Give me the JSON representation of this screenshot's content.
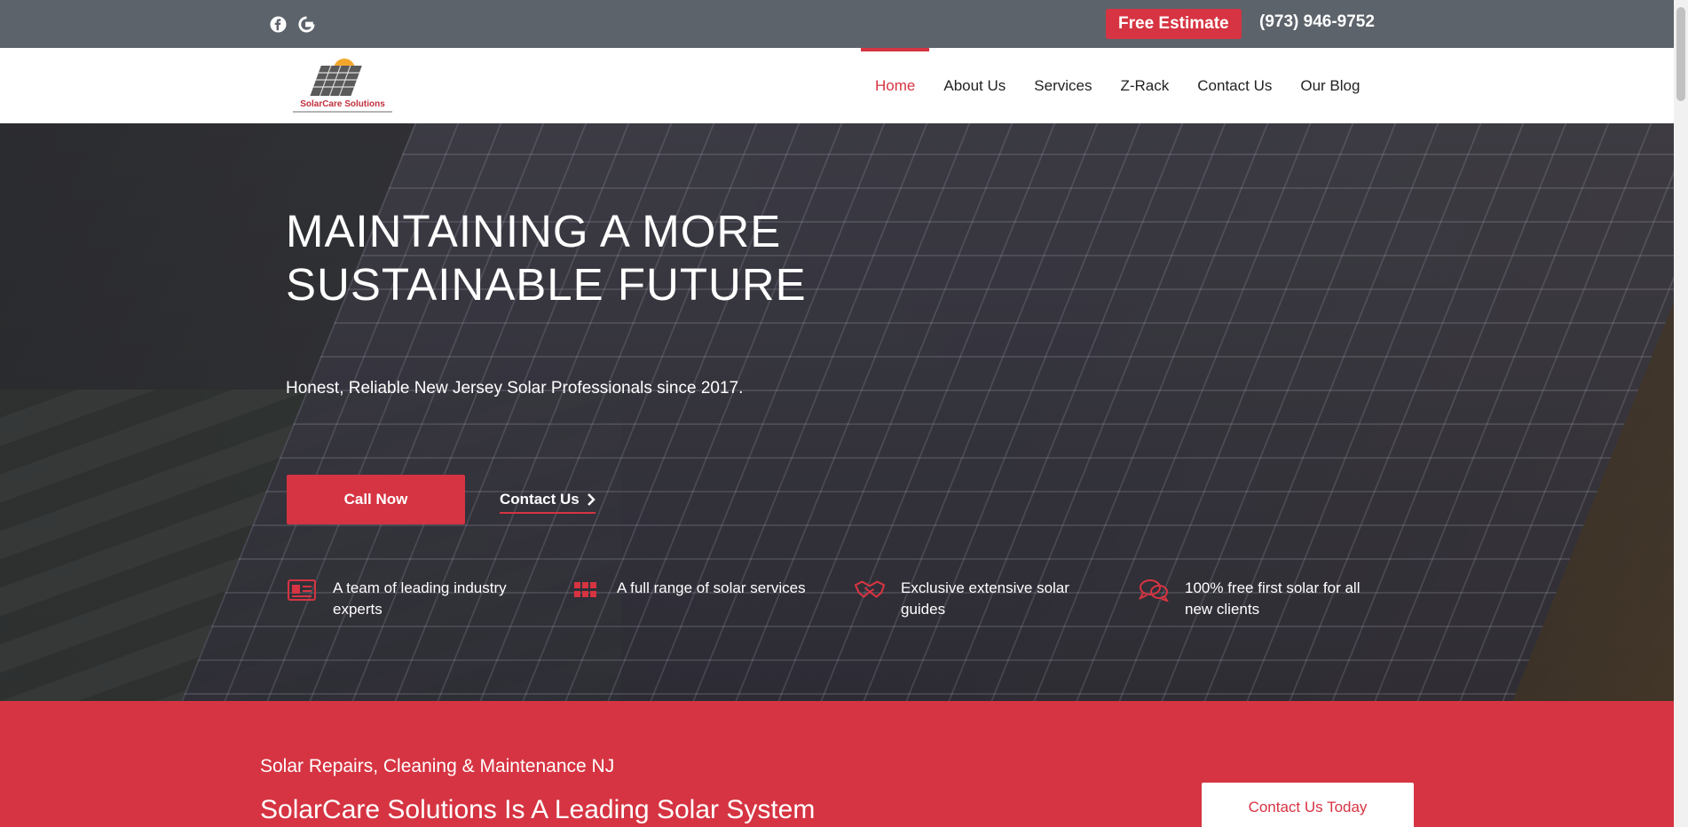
{
  "topbar": {
    "social": [
      {
        "icon": "facebook-icon"
      },
      {
        "icon": "google-icon"
      }
    ],
    "free_estimate": "Free Estimate",
    "phone": "(973) 946-9752"
  },
  "header": {
    "logo_text": "SolarCare Solutions",
    "nav": [
      {
        "label": "Home",
        "active": true
      },
      {
        "label": "About Us"
      },
      {
        "label": "Services"
      },
      {
        "label": "Z-Rack"
      },
      {
        "label": "Contact Us"
      },
      {
        "label": "Our Blog"
      }
    ]
  },
  "hero": {
    "title_line1": "MAINTAINING A MORE",
    "title_line2": "SUSTAINABLE FUTURE",
    "subtitle": "Honest, Reliable New Jersey Solar Professionals since 2017.",
    "call_button": "Call Now",
    "contact_link": "Contact Us",
    "features": [
      {
        "icon": "id-card-icon",
        "text": "A team of leading industry experts"
      },
      {
        "icon": "grid-icon",
        "text": "A full range of solar services"
      },
      {
        "icon": "handshake-icon",
        "text": "Exclusive extensive solar guides"
      },
      {
        "icon": "chat-bubbles-icon",
        "text": "100% free first solar for all new clients"
      }
    ]
  },
  "band": {
    "subtitle": "Solar Repairs, Cleaning & Maintenance NJ",
    "title": "SolarCare Solutions Is A Leading Solar System",
    "button": "Contact Us Today"
  },
  "colors": {
    "accent": "#d63442",
    "topbar": "#5d636b"
  }
}
